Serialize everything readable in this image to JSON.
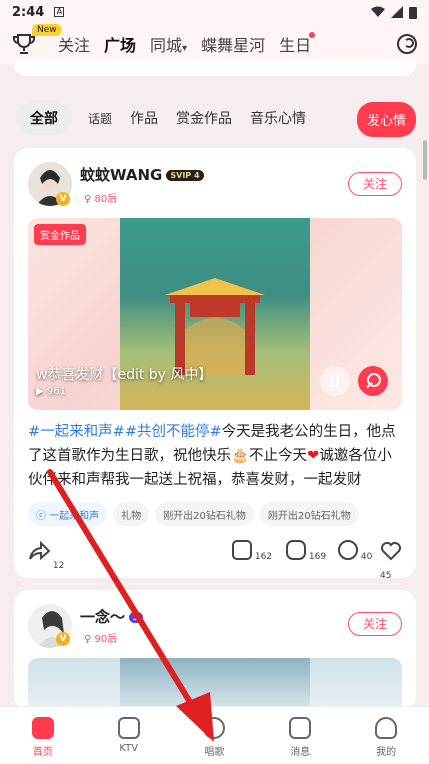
{
  "status": {
    "time": "2:44",
    "a_label": "A"
  },
  "topnav": {
    "new_badge": "New",
    "tabs": [
      {
        "label": "关注"
      },
      {
        "label": "广场"
      },
      {
        "label": "同城"
      },
      {
        "label": "蝶舞星河"
      },
      {
        "label": "生日"
      }
    ]
  },
  "filters": {
    "chips": [
      "全部",
      "话题",
      "作品",
      "赏金作品",
      "音乐心情"
    ],
    "post_button": "发心情"
  },
  "post1": {
    "username": "蚊蚊WANG",
    "svip": "SVIP 4",
    "age": "80后",
    "follow": "关注",
    "reward_tag": "赏金作品",
    "song_title": "w恭喜发财【edit by 风中】",
    "plays": "961",
    "text_tags": [
      "#一起来和声#",
      "#共创不能停#"
    ],
    "text_body": "今天是我老公的生日，他点了这首歌作为生日歌，祝他快乐🎂不止今天",
    "text_tail": "诚邀各位小伙伴来和声帮我一起送上祝福，恭喜发财，一起发财",
    "chips": [
      "一起来和声",
      "礼物",
      "刚开出20钻石礼物",
      "刚开出20钻石礼物"
    ],
    "actions": {
      "share": "12",
      "gift": "162",
      "comment": "169",
      "listen": "40",
      "like": "45"
    }
  },
  "post2": {
    "username": "一念～",
    "level": "3",
    "age": "90后",
    "follow": "关注"
  },
  "bottomnav": [
    {
      "label": "首页"
    },
    {
      "label": "KTV"
    },
    {
      "label": "唱歌"
    },
    {
      "label": "消息"
    },
    {
      "label": "我的"
    }
  ],
  "colors": {
    "accent": "#ff3b4f",
    "tag_blue": "#2f7de1",
    "arrow": "#e02020"
  }
}
